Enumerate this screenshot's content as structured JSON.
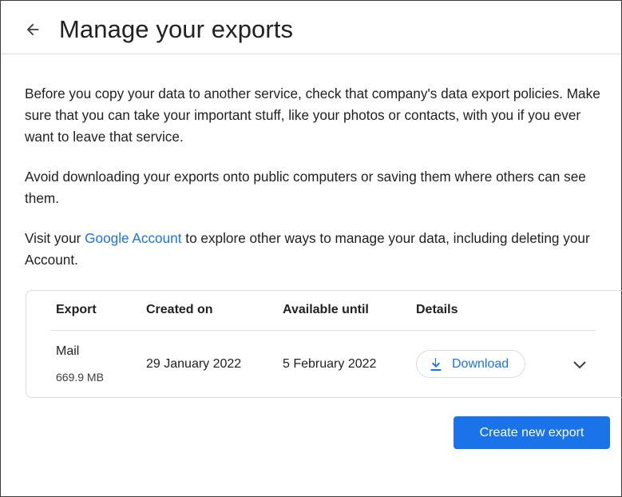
{
  "header": {
    "title": "Manage your exports"
  },
  "intro": {
    "p1": "Before you copy your data to another service, check that company's data export policies. Make sure that you can take your important stuff, like your photos or contacts, with you if you ever want to leave that service.",
    "p2": "Avoid downloading your exports onto public computers or saving them where others can see them.",
    "p3_before": "Visit your ",
    "p3_link": "Google Account",
    "p3_after": " to explore other ways to manage your data, including deleting your Account."
  },
  "table": {
    "columns": [
      "Export",
      "Created on",
      "Available until",
      "Details"
    ],
    "rows": [
      {
        "export_name": "Mail",
        "export_size": "669.9 MB",
        "created_on": "29 January 2022",
        "available_until": "5 February 2022",
        "download_label": "Download"
      }
    ]
  },
  "actions": {
    "create_label": "Create new export"
  },
  "icons": {
    "back": "arrow-back-icon",
    "download": "download-icon",
    "expand": "chevron-down-icon"
  },
  "colors": {
    "accent": "#1a73e8",
    "text": "#202124",
    "divider": "#dadce0"
  }
}
